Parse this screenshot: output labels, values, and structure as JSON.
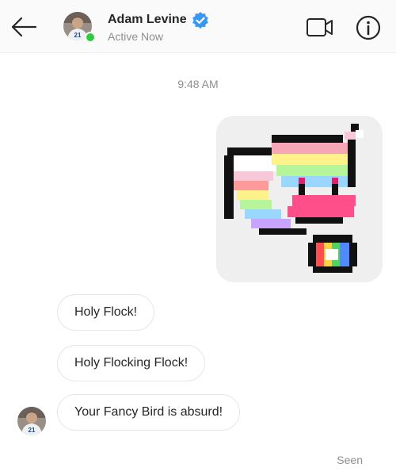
{
  "header": {
    "contact_name": "Adam Levine",
    "status": "Active Now",
    "back_icon": "arrow-left-icon",
    "verified_icon": "verified-badge-icon",
    "video_icon": "video-camera-icon",
    "info_icon": "info-icon",
    "verified_color": "#3897f0",
    "online_color": "#2ecc40"
  },
  "conversation": {
    "timestamp": "9:48 AM",
    "sticker": {
      "icon": "rainbow-bird-sticker"
    },
    "messages": [
      {
        "text": "Holy Flock!"
      },
      {
        "text": "Holy Flocking Flock!"
      },
      {
        "text": "Your Fancy Bird is absurd!"
      }
    ],
    "seen_label": "Seen"
  }
}
